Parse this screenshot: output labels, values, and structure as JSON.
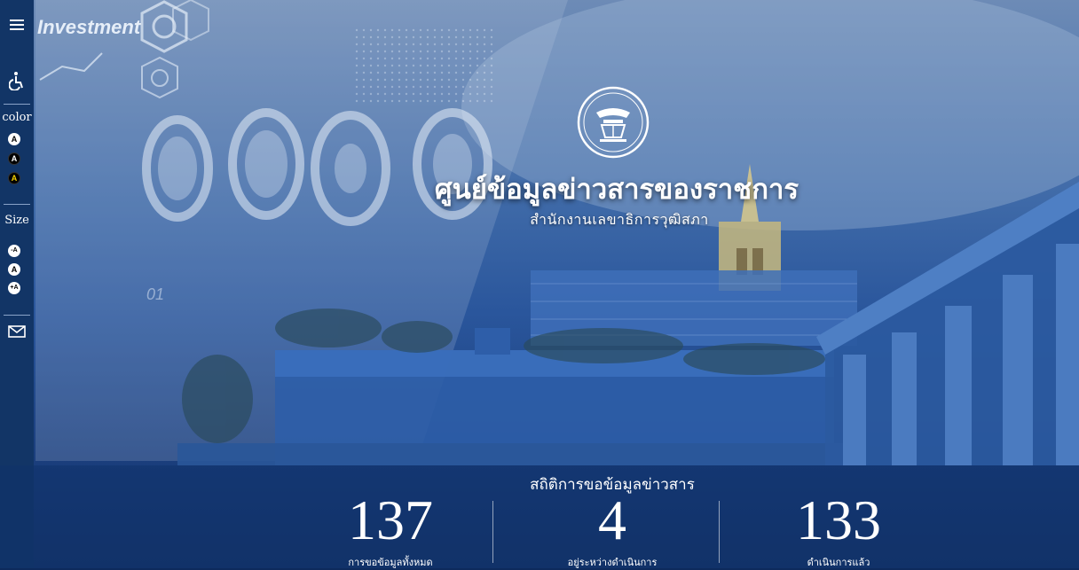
{
  "sidebar": {
    "color_label": "color",
    "size_label": "Size",
    "color_options": [
      "A",
      "A",
      "A"
    ],
    "size_options": [
      "-A",
      "A",
      "+A"
    ]
  },
  "header": {
    "title": "ศูนย์ข้อมูลข่าวสารของราชการ",
    "subtitle": "สำนักงานเลขาธิการวุฒิสภา"
  },
  "background": {
    "investment_text": "Investment",
    "number_text": "01"
  },
  "stats": {
    "title": "สถิติการขอข้อมูลข่าวสาร",
    "items": [
      {
        "value": "137",
        "label": "การขอข้อมูลทั้งหมด"
      },
      {
        "value": "4",
        "label": "อยู่ระหว่างดำเนินการ"
      },
      {
        "value": "133",
        "label": "ดำเนินการแล้ว"
      }
    ]
  }
}
